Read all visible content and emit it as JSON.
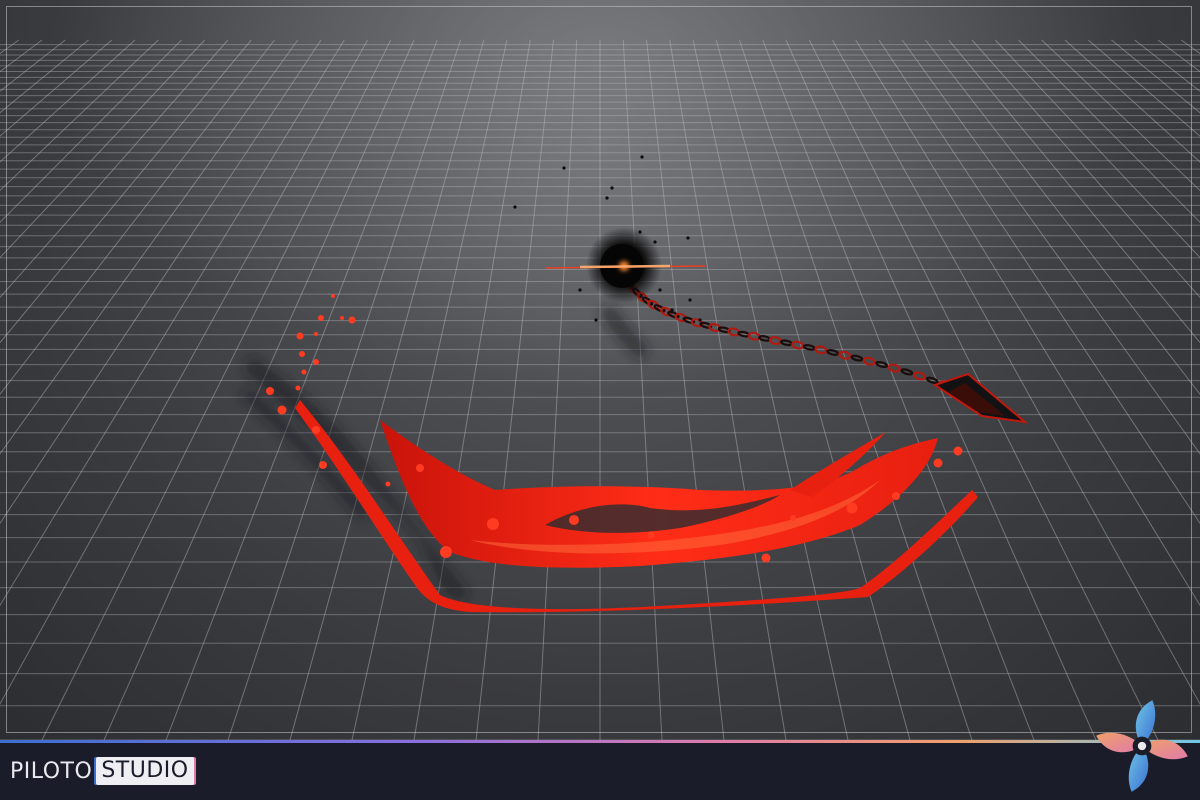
{
  "footer": {
    "brand_first": "PILOTO",
    "brand_second": "STUDIO"
  },
  "icons": {
    "logo": "propeller-logo-icon",
    "effect": "chain-blade-slash-vfx"
  },
  "colors": {
    "accent_red": "#ff2d17",
    "footer_bg": "#1b1c2a",
    "grid_line": "#b8bcc4"
  }
}
